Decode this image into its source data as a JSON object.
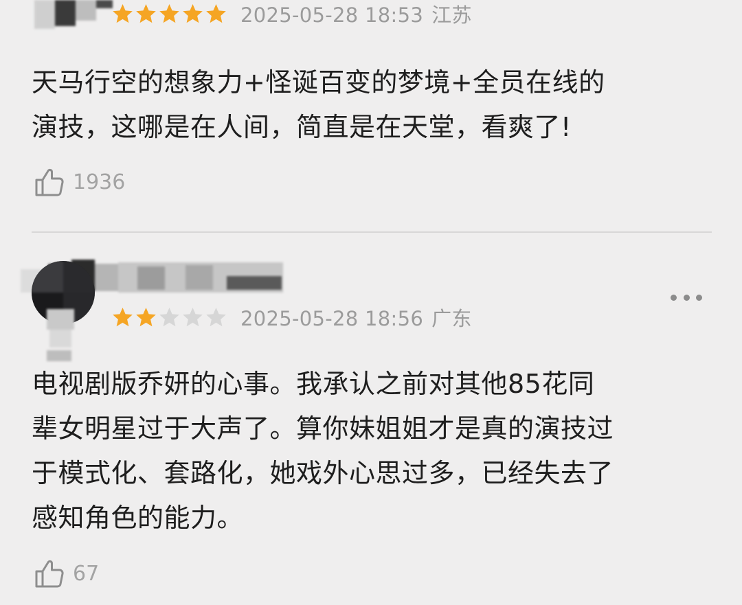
{
  "reviews": [
    {
      "rating": 5,
      "max_rating": 5,
      "date": "2025-05-28 18:53",
      "location": "江苏",
      "text": "天马行空的想象力+怪诞百变的梦境+全员在线的\n演技，这哪是在人间，简直是在天堂，看爽了!",
      "likes": "1936"
    },
    {
      "rating": 2,
      "max_rating": 5,
      "date": "2025-05-28 18:56",
      "location": "广东",
      "text": "电视剧版乔妍的心事。我承认之前对其他85花同\n辈女明星过于大声了。算你妹姐姐才是真的演技过\n于模式化、套路化，她戏外心思过多，已经失去了\n感知角色的能力。",
      "likes": "67"
    }
  ],
  "colors": {
    "star_filled": "#f5a524",
    "star_empty": "#d6d6d6",
    "meta_text": "#9b9b9b",
    "background": "#efeeee"
  },
  "icons": {
    "rating_star": "star-icon",
    "like": "thumbs-up-icon",
    "more": "more-dots-icon"
  }
}
